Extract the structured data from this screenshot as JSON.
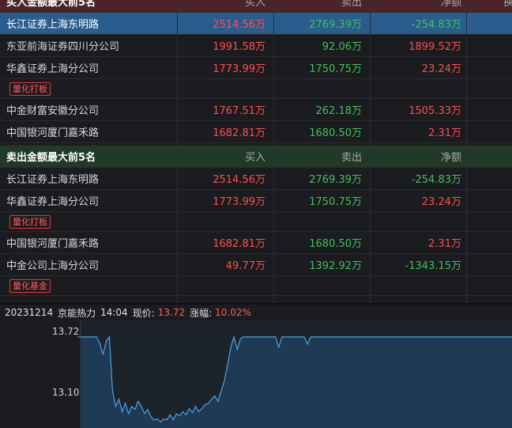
{
  "buy_section": {
    "title": "买入金额最大前5名",
    "headers": [
      "买入",
      "卖出",
      "净额",
      "换"
    ],
    "rows": [
      {
        "name": "长江证券上海东明路",
        "buy": "2514.56万",
        "sell": "2769.39万",
        "net": "-254.83万",
        "net_sign": "neg",
        "tag": ""
      },
      {
        "name": "东亚前海证券四川分公司",
        "buy": "1991.58万",
        "sell": "92.06万",
        "net": "1899.52万",
        "net_sign": "pos",
        "tag": ""
      },
      {
        "name": "华鑫证券上海分公司",
        "buy": "1773.99万",
        "sell": "1750.75万",
        "net": "23.24万",
        "net_sign": "pos",
        "tag": "量化打板"
      },
      {
        "name": "中金财富安徽分公司",
        "buy": "1767.51万",
        "sell": "262.18万",
        "net": "1505.33万",
        "net_sign": "pos",
        "tag": ""
      },
      {
        "name": "中国银河厦门嘉禾路",
        "buy": "1682.81万",
        "sell": "1680.50万",
        "net": "2.31万",
        "net_sign": "pos",
        "tag": ""
      }
    ]
  },
  "sell_section": {
    "title": "卖出金额最大前5名",
    "headers": [
      "买入",
      "卖出",
      "净额"
    ],
    "rows": [
      {
        "name": "长江证券上海东明路",
        "buy": "2514.56万",
        "sell": "2769.39万",
        "net": "-254.83万",
        "net_sign": "neg",
        "tag": ""
      },
      {
        "name": "华鑫证券上海分公司",
        "buy": "1773.99万",
        "sell": "1750.75万",
        "net": "23.24万",
        "net_sign": "pos",
        "tag": "量化打板"
      },
      {
        "name": "中国银河厦门嘉禾路",
        "buy": "1682.81万",
        "sell": "1680.50万",
        "net": "2.31万",
        "net_sign": "pos",
        "tag": ""
      },
      {
        "name": "中金公司上海分公司",
        "buy": "49.77万",
        "sell": "1392.92万",
        "net": "-1343.15万",
        "net_sign": "neg",
        "tag": "量化基金"
      }
    ]
  },
  "chart_header": {
    "date": "20231214",
    "stock": "京能热力",
    "time": "14:04",
    "price_label": "现价:",
    "price": "13.72",
    "change_label": "涨幅:",
    "change": "10.02%"
  },
  "chart_data": {
    "type": "line",
    "y_tick_labels": [
      "13.72",
      "13.10"
    ],
    "ylim": [
      12.85,
      13.78
    ],
    "series": [
      {
        "values": [
          13.72,
          13.72,
          13.72,
          13.72,
          13.72,
          13.72,
          13.66,
          13.55,
          13.68,
          13.72,
          13.2,
          13.05,
          13.12,
          13.0,
          13.08,
          12.98,
          13.05,
          13.02,
          13.1,
          13.05,
          12.98,
          13.02,
          12.95,
          12.92,
          12.93,
          12.9,
          12.93,
          12.92,
          12.97,
          12.92,
          12.98,
          12.96,
          13.0,
          12.97,
          13.03,
          12.99,
          13.05,
          13.0,
          13.03,
          13.07,
          13.08,
          13.12,
          13.15,
          13.1,
          13.2,
          13.3,
          13.45,
          13.62,
          13.72,
          13.6,
          13.7,
          13.72,
          13.72,
          13.72,
          13.72,
          13.72,
          13.72,
          13.72,
          13.72,
          13.72,
          13.72,
          13.72,
          13.62,
          13.72,
          13.72,
          13.72,
          13.72,
          13.72,
          13.72,
          13.72,
          13.72,
          13.65,
          13.72,
          13.72,
          13.72,
          13.72,
          13.72,
          13.72,
          13.72,
          13.72,
          13.72,
          13.72,
          13.72,
          13.72,
          13.72,
          13.72,
          13.72,
          13.72,
          13.72,
          13.72,
          13.72,
          13.72,
          13.72,
          13.72,
          13.72,
          13.72,
          13.72,
          13.72,
          13.72,
          13.72,
          13.72,
          13.72,
          13.72,
          13.72,
          13.72,
          13.72,
          13.72,
          13.72,
          13.72,
          13.72,
          13.72,
          13.72,
          13.72,
          13.72,
          13.72,
          13.72,
          13.72,
          13.72,
          13.72,
          13.72,
          13.72,
          13.72,
          13.72,
          13.72,
          13.72,
          13.72,
          13.72,
          13.72,
          13.72,
          13.72,
          13.72,
          13.72,
          13.72,
          13.72,
          13.72,
          13.72
        ]
      }
    ],
    "colors": {
      "line": "#4aa3e8",
      "fill": "#1f3a55"
    }
  }
}
